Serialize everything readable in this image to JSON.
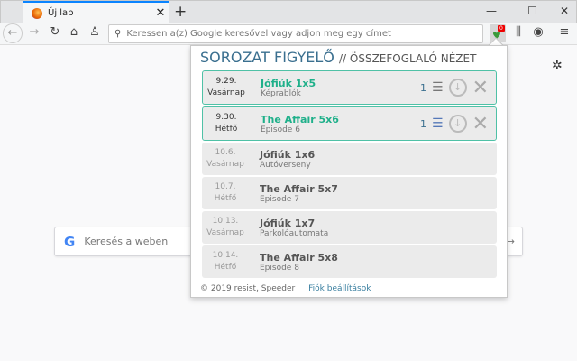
{
  "browser": {
    "tab_title": "Új lap",
    "url_placeholder": "Keressen a(z) Google keresővel vagy adjon meg egy címet",
    "ext_badge": "0"
  },
  "newtab": {
    "search_placeholder": "Keresés a weben"
  },
  "popup": {
    "title": "SOROZAT FIGYELŐ",
    "subtitle": "// ÖSSZEFOGLALÓ NÉZET",
    "rows": [
      {
        "date": "9.29.",
        "day": "Vasárnap",
        "show": "Jófiúk 1x5",
        "episode": "Képrablók",
        "count": "1",
        "highlight": true
      },
      {
        "date": "9.30.",
        "day": "Hétfő",
        "show": "The Affair 5x6",
        "episode": "Episode 6",
        "count": "1",
        "highlight": true
      },
      {
        "date": "10.6.",
        "day": "Vasárnap",
        "show": "Jófiúk 1x6",
        "episode": "Autóverseny"
      },
      {
        "date": "10.7.",
        "day": "Hétfő",
        "show": "The Affair 5x7",
        "episode": "Episode 7"
      },
      {
        "date": "10.13.",
        "day": "Vasárnap",
        "show": "Jófiúk 1x7",
        "episode": "Parkolóautomata"
      },
      {
        "date": "10.14.",
        "day": "Hétfő",
        "show": "The Affair 5x8",
        "episode": "Episode 8"
      }
    ],
    "copyright": "© 2019 resist, Speeder",
    "settings_link": "Fiók beállítások"
  },
  "colors": {
    "accent": "#1fb08a",
    "title": "#3a6f8f",
    "badge": "#ee0000"
  }
}
